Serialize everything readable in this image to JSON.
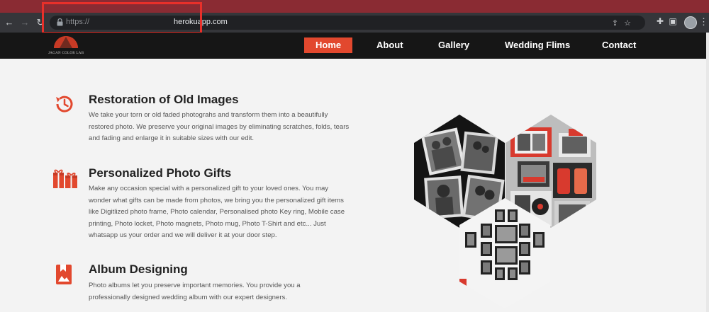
{
  "browser": {
    "url_scheme": "https://",
    "url_host": "herokuapp.com"
  },
  "site": {
    "logo_text": "JAGAN COLOR LAB",
    "nav": [
      {
        "label": "Home",
        "active": true
      },
      {
        "label": "About",
        "active": false
      },
      {
        "label": "Gallery",
        "active": false
      },
      {
        "label": "Wedding Flims",
        "active": false
      },
      {
        "label": "Contact",
        "active": false
      }
    ]
  },
  "features": [
    {
      "icon": "history-icon",
      "title": "Restoration of Old Images",
      "description": "We take your torn or old faded photograhs and transform them into a beautifully restored photo. We preserve your original images by eliminating scratches, folds, tears and fading and enlarge it in suitable sizes with our edit."
    },
    {
      "icon": "gift-icon",
      "title": "Personalized Photo Gifts",
      "description": "Make any occasion special with a personalized gift to your loved ones. You may wonder what gifts can be made from photos, we bring you the personalized gift items like Digitlized photo frame, Photo calendar, Personalised photo Key ring, Mobile case printing, Photo locket, Photo magnets, Photo mug, Photo T-Shirt and etc... Just whatsapp us your order and we will deliver it at your door step."
    },
    {
      "icon": "album-icon",
      "title": "Album Designing",
      "description": "Photo albums let you preserve important memories. You provide you a professionally designed wedding album with our expert designers."
    }
  ],
  "colors": {
    "accent": "#e2482e",
    "nav_bg": "#161616",
    "highlight": "#e8302a"
  }
}
